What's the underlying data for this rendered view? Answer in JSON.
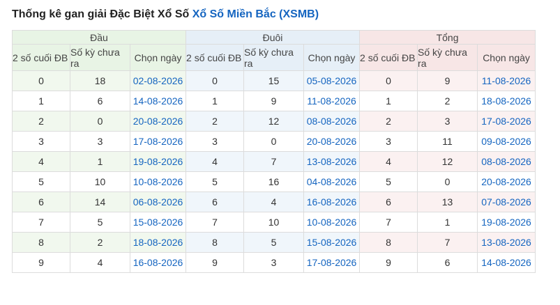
{
  "title": {
    "prefix": "Thống kê gan giải Đặc Biệt Xổ Số ",
    "link": "Xổ Số Miền Bắc (XSMB)"
  },
  "groups": [
    "Đầu",
    "Đuôi",
    "Tổng"
  ],
  "columns": {
    "col1": "2 số cuối ĐB",
    "col2": "Số kỳ chưa ra",
    "col3": "Chọn ngày"
  },
  "rows": [
    {
      "dau": [
        "0",
        "18",
        "02-08-2026"
      ],
      "duoi": [
        "0",
        "15",
        "05-08-2026"
      ],
      "tong": [
        "0",
        "9",
        "11-08-2026"
      ]
    },
    {
      "dau": [
        "1",
        "6",
        "14-08-2026"
      ],
      "duoi": [
        "1",
        "9",
        "11-08-2026"
      ],
      "tong": [
        "1",
        "2",
        "18-08-2026"
      ]
    },
    {
      "dau": [
        "2",
        "0",
        "20-08-2026"
      ],
      "duoi": [
        "2",
        "12",
        "08-08-2026"
      ],
      "tong": [
        "2",
        "3",
        "17-08-2026"
      ]
    },
    {
      "dau": [
        "3",
        "3",
        "17-08-2026"
      ],
      "duoi": [
        "3",
        "0",
        "20-08-2026"
      ],
      "tong": [
        "3",
        "11",
        "09-08-2026"
      ]
    },
    {
      "dau": [
        "4",
        "1",
        "19-08-2026"
      ],
      "duoi": [
        "4",
        "7",
        "13-08-2026"
      ],
      "tong": [
        "4",
        "12",
        "08-08-2026"
      ]
    },
    {
      "dau": [
        "5",
        "10",
        "10-08-2026"
      ],
      "duoi": [
        "5",
        "16",
        "04-08-2026"
      ],
      "tong": [
        "5",
        "0",
        "20-08-2026"
      ]
    },
    {
      "dau": [
        "6",
        "14",
        "06-08-2026"
      ],
      "duoi": [
        "6",
        "4",
        "16-08-2026"
      ],
      "tong": [
        "6",
        "13",
        "07-08-2026"
      ]
    },
    {
      "dau": [
        "7",
        "5",
        "15-08-2026"
      ],
      "duoi": [
        "7",
        "10",
        "10-08-2026"
      ],
      "tong": [
        "7",
        "1",
        "19-08-2026"
      ]
    },
    {
      "dau": [
        "8",
        "2",
        "18-08-2026"
      ],
      "duoi": [
        "8",
        "5",
        "15-08-2026"
      ],
      "tong": [
        "8",
        "7",
        "13-08-2026"
      ]
    },
    {
      "dau": [
        "9",
        "4",
        "16-08-2026"
      ],
      "duoi": [
        "9",
        "3",
        "17-08-2026"
      ],
      "tong": [
        "9",
        "6",
        "14-08-2026"
      ]
    }
  ],
  "colors": {
    "link": "#1565c0",
    "dau_header": "#e8f4e5",
    "duoi_header": "#e6eff7",
    "tong_header": "#f7e6e6"
  }
}
